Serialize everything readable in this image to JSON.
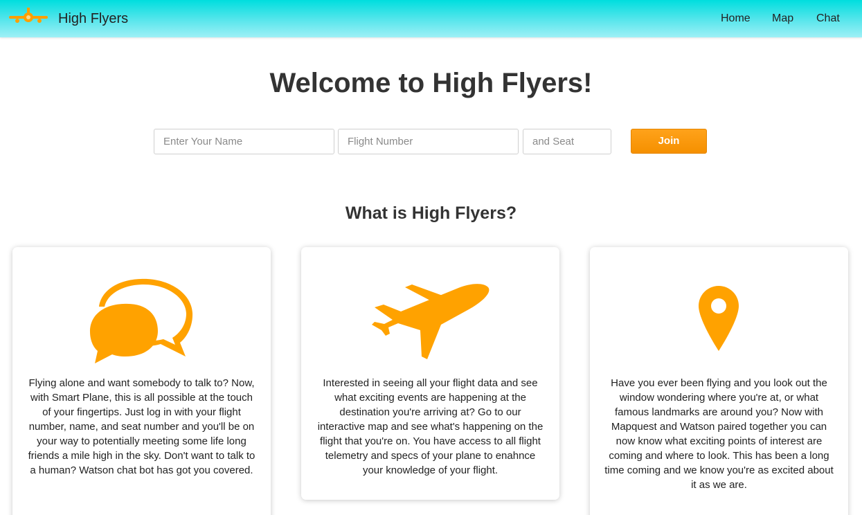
{
  "navbar": {
    "brand": "High Flyers",
    "links": [
      "Home",
      "Map",
      "Chat"
    ]
  },
  "hero": {
    "title": "Welcome to High Flyers!"
  },
  "form": {
    "name_placeholder": "Enter Your Name",
    "flight_placeholder": "Flight Number",
    "seat_placeholder": "and Seat",
    "join_label": "Join"
  },
  "about": {
    "title": "What is High Flyers?",
    "cards": [
      {
        "icon": "chat-bubbles-icon",
        "text": "Flying alone and want somebody to talk to? Now, with Smart Plane, this is all possible at the touch of your fingertips. Just log in with your flight number, name, and seat number and you'll be on your way to potentially meeting some life long friends a mile high in the sky. Don't want to talk to a human? Watson chat bot has got you covered."
      },
      {
        "icon": "airplane-icon",
        "text": "Interested in seeing all your flight data and see what exciting events are happening at the destination you're arriving at? Go to our interactive map and see what's happening on the flight that you're on. You have access to all flight telemetry and specs of your plane to enahnce your knowledge of your flight."
      },
      {
        "icon": "map-pin-icon",
        "text": "Have you ever been flying and you look out the window wondering where you're at, or what famous landmarks are around you? Now with Mapquest and Watson paired together you can now know what exciting points of interest are coming and where to look. This has been a long time coming and we know you're as excited about it as we are."
      }
    ]
  },
  "colors": {
    "accent": "#ffa200",
    "navbar_top": "#00dede",
    "navbar_bottom": "#9ff0f6",
    "join_button": "#f59000"
  }
}
